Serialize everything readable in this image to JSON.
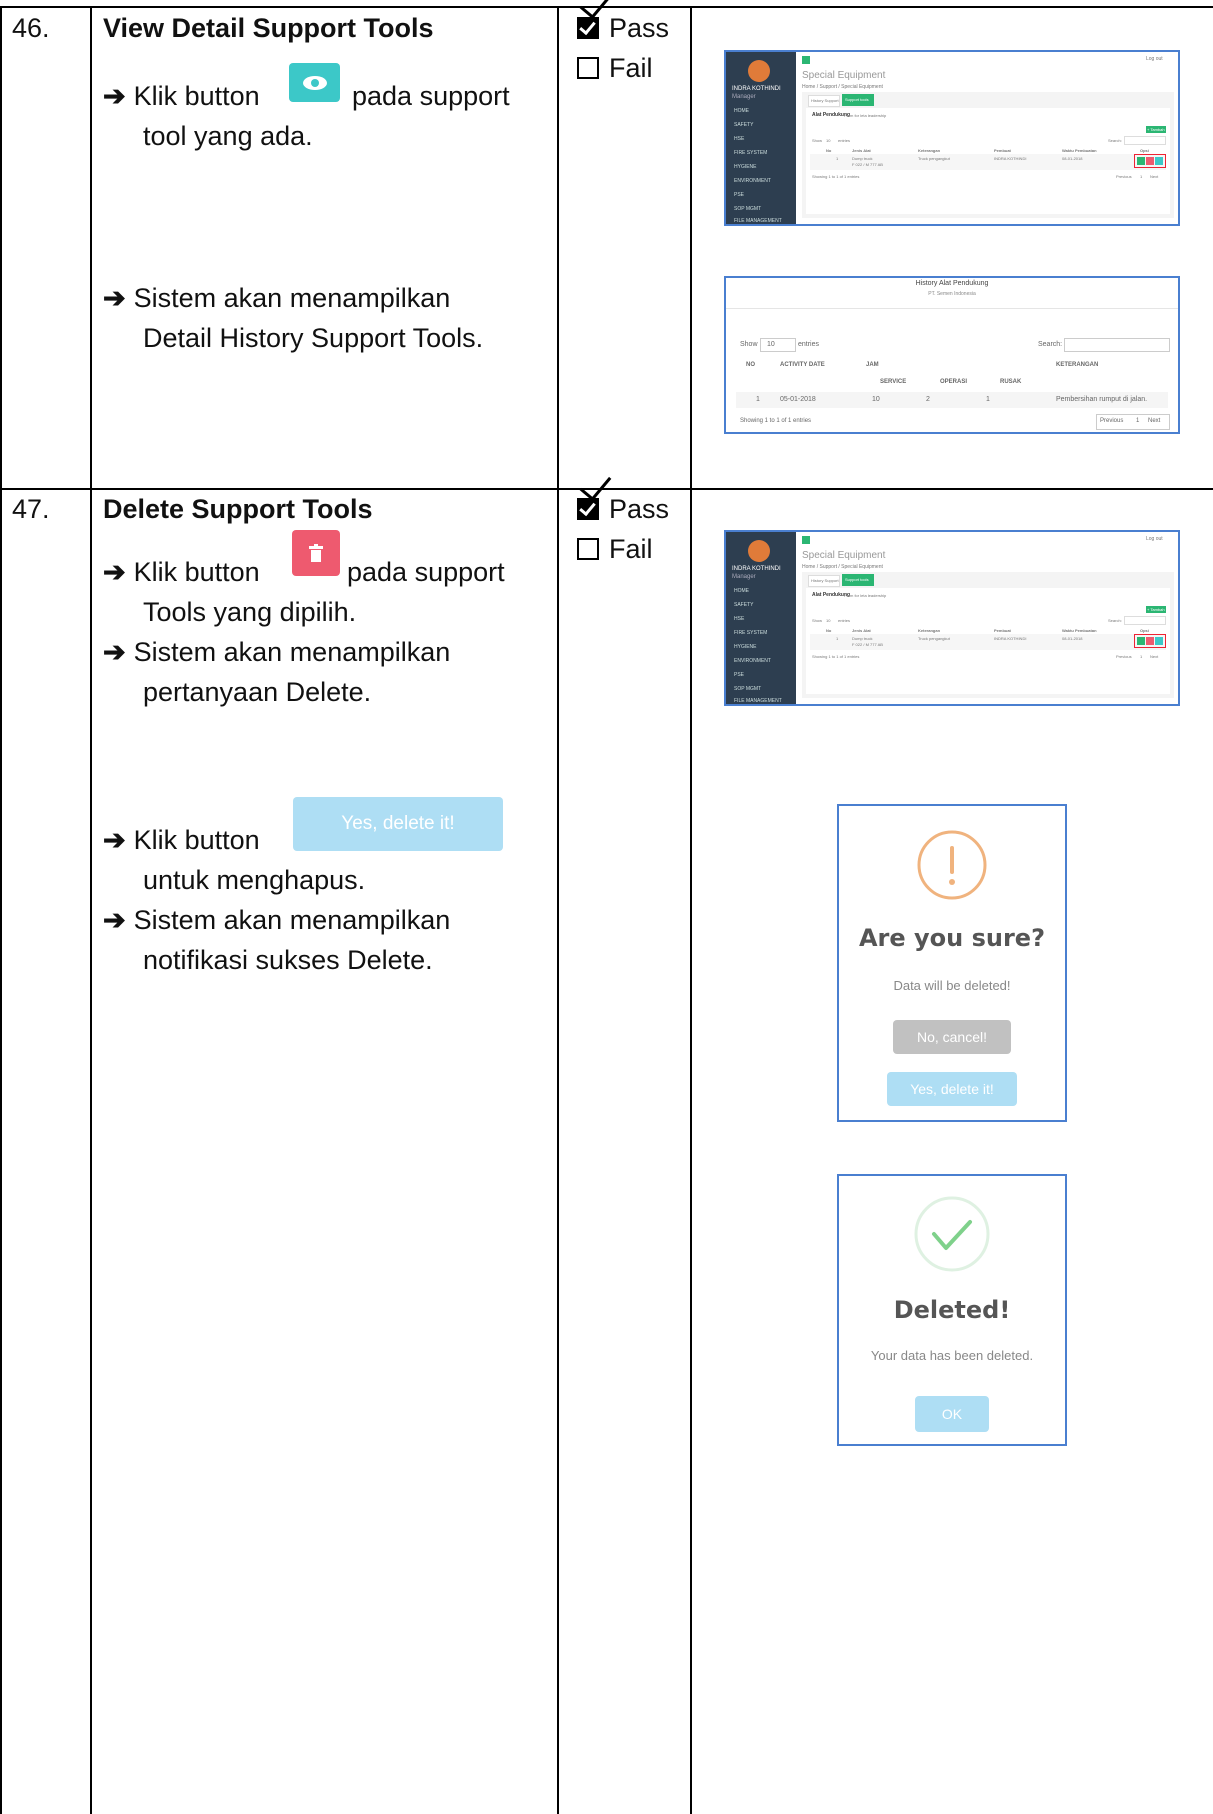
{
  "rows": [
    {
      "number": "46.",
      "title": "View Detail Support Tools",
      "steps": [
        {
          "before": "Klik button",
          "after": "pada support",
          "line2": "tool yang ada."
        },
        {
          "line1": "Sistem akan menampilkan",
          "line2": "Detail History Support Tools."
        }
      ],
      "status": {
        "pass_label": "Pass",
        "fail_label": "Fail",
        "pass_checked": true
      },
      "screen1": {
        "user": "INDRA KOTHINDI",
        "user_role": "Manager",
        "logout": "Log out",
        "page_title": "Special Equipment",
        "breadcrumb": "Home / Support / Special Equipment",
        "tab_history": "History Support",
        "tab_support": "Support tools",
        "panel_title": "Alat Pendukung",
        "panel_sub": "Form for leta leadership",
        "show": "Show",
        "entries_val": "10",
        "entries": "entries",
        "search": "Search:",
        "add_btn": "+ Tambah",
        "columns": [
          "No",
          "Jenis Alat",
          "Keterangan",
          "Pembuat",
          "Waktu Pembuatan",
          "Opsi"
        ],
        "row": {
          "no": "1",
          "jenis": "Dump truck",
          "jenis2": "F 022 / M 777 AB",
          "ket": "Truck pengangkut",
          "pembuat": "INDRA KOTHINDI",
          "waktu": "08-01-2018"
        },
        "showing": "Showing 1 to 1 of 1 entries",
        "previous": "Previous",
        "page": "1",
        "next": "Next",
        "menu": [
          "HOME",
          "SAFETY",
          "HSE",
          "FIRE SYSTEM",
          "HYGIENE",
          "ENVIRONMENT",
          "PSE",
          "SOP MGMT",
          "FILE MANAGEMENT"
        ]
      },
      "screen2": {
        "title": "History Alat Pendukung",
        "subtitle": "PT. Semen Indonesia",
        "show": "Show",
        "entries_val": "10",
        "entries": "entries",
        "search": "Search:",
        "col_no": "NO",
        "col_date": "ACTIVITY DATE",
        "col_jam": "JAM",
        "col_ket": "KETERANGAN",
        "col_service": "SERVICE",
        "col_operasi": "OPERASI",
        "col_rusak": "RUSAK",
        "row": {
          "no": "1",
          "date": "05-01-2018",
          "service": "10",
          "operasi": "2",
          "rusak": "1",
          "ket": "Pembersihan rumput di jalan."
        },
        "showing": "Showing 1 to 1 of 1 entries",
        "previous": "Previous",
        "page": "1",
        "next": "Next"
      }
    },
    {
      "number": "47.",
      "title": "Delete Support Tools",
      "steps": [
        {
          "before": "Klik button",
          "after": "pada support",
          "line2": "Tools yang dipilih."
        },
        {
          "line1": "Sistem akan menampilkan",
          "line2": "pertanyaan Delete."
        },
        {
          "before": "Klik button",
          "inline_button": "Yes, delete it!",
          "line2": "untuk menghapus."
        },
        {
          "line1": "Sistem akan menampilkan",
          "line2": "notifikasi sukses Delete."
        }
      ],
      "status": {
        "pass_label": "Pass",
        "fail_label": "Fail",
        "pass_checked": true
      },
      "confirm_modal": {
        "title": "Are you sure?",
        "text": "Data will be deleted!",
        "cancel": "No, cancel!",
        "confirm": "Yes, delete it!"
      },
      "success_modal": {
        "title": "Deleted!",
        "text": "Your data has been deleted.",
        "ok": "OK"
      }
    }
  ],
  "colors": {
    "view_button": "#3cc8c8",
    "delete_button": "#ee5a6f",
    "confirm_button": "#aedef4",
    "cancel_button": "#c1c1c1",
    "warning_icon": "#f0b37e",
    "success_icon": "#7fd18b",
    "screenshot_border": "#4a7fd0"
  }
}
